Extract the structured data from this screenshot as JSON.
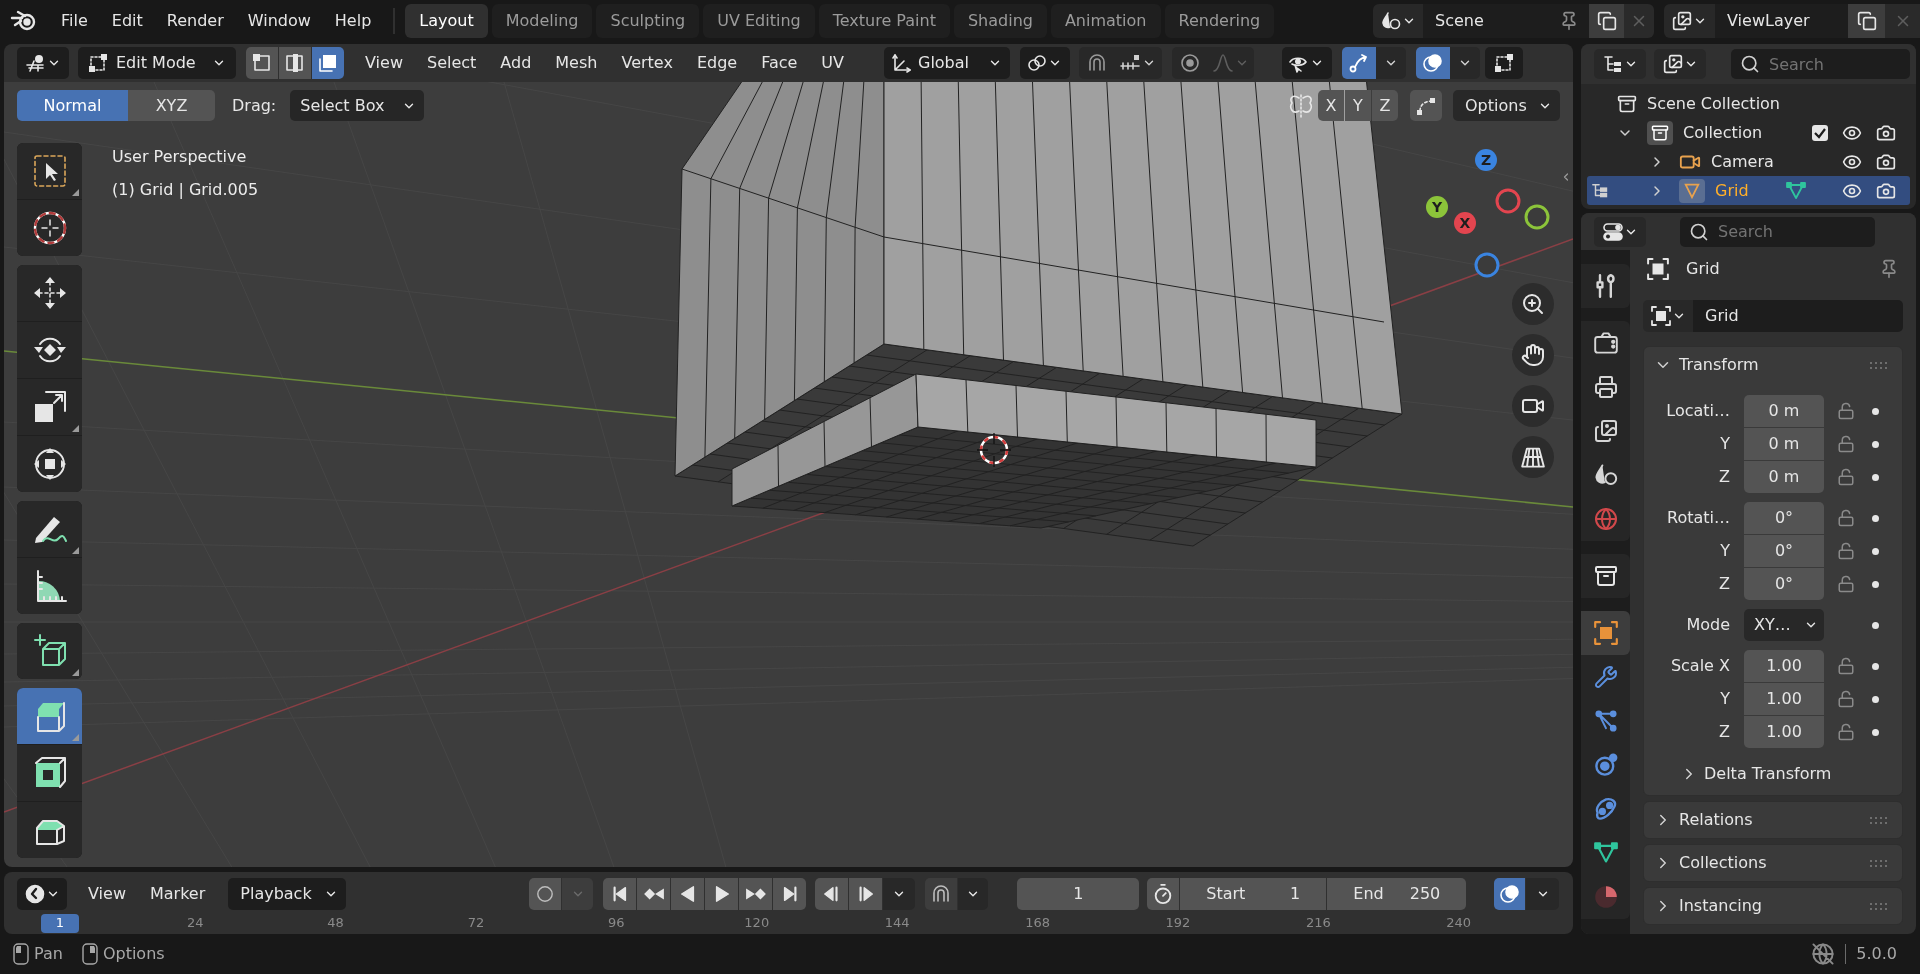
{
  "top_bar": {
    "menus": [
      "File",
      "Edit",
      "Render",
      "Window",
      "Help"
    ],
    "workspaces": [
      {
        "label": "Layout",
        "selected": true
      },
      {
        "label": "Modeling",
        "selected": false
      },
      {
        "label": "Sculpting",
        "selected": false
      },
      {
        "label": "UV Editing",
        "selected": false
      },
      {
        "label": "Texture Paint",
        "selected": false
      },
      {
        "label": "Shading",
        "selected": false
      },
      {
        "label": "Animation",
        "selected": false
      },
      {
        "label": "Rendering",
        "selected": false
      }
    ],
    "scene": "Scene",
    "view_layer": "ViewLayer"
  },
  "viewport": {
    "header": {
      "mode": "Edit Mode",
      "select_modes": [
        {
          "kind": "vertex",
          "selected": false
        },
        {
          "kind": "edge",
          "selected": false
        },
        {
          "kind": "face",
          "selected": true
        }
      ],
      "menus": [
        "View",
        "Select",
        "Add",
        "Mesh",
        "Vertex",
        "Edge",
        "Face",
        "UV"
      ],
      "orientation": "Global",
      "toggles": [
        {
          "kind": "snap",
          "on": false
        },
        {
          "kind": "proportional",
          "on": false
        },
        {
          "kind": "gizmos",
          "on": true
        },
        {
          "kind": "overlays",
          "on": true
        }
      ]
    },
    "tool_settings": {
      "orientations": [
        {
          "label": "Normal",
          "selected": true
        },
        {
          "label": "XYZ",
          "selected": false
        }
      ],
      "drag_label": "Drag:",
      "drag_value": "Select Box",
      "mirror_axes": [
        {
          "label": "X",
          "selected": false
        },
        {
          "label": "Y",
          "selected": false
        },
        {
          "label": "Z",
          "selected": false
        }
      ],
      "options": "Options"
    },
    "info": {
      "view": "User Perspective",
      "object": "(1) Grid | Grid.005"
    },
    "tool_groups": [
      {
        "tools": [
          {
            "kind": "select_box",
            "selected": false,
            "submenu": true
          },
          {
            "kind": "cursor",
            "selected": false,
            "submenu": false
          }
        ]
      },
      {
        "tools": [
          {
            "kind": "move",
            "selected": false,
            "submenu": false
          },
          {
            "kind": "rotate",
            "selected": false,
            "submenu": false
          },
          {
            "kind": "scale",
            "selected": false,
            "submenu": true
          },
          {
            "kind": "transform",
            "selected": false,
            "submenu": false
          }
        ]
      },
      {
        "tools": [
          {
            "kind": "annotate",
            "selected": false,
            "submenu": true
          },
          {
            "kind": "measure",
            "selected": false,
            "submenu": false
          }
        ]
      },
      {
        "tools": [
          {
            "kind": "add_cube",
            "selected": false,
            "submenu": true
          }
        ]
      },
      {
        "tools": [
          {
            "kind": "extrude",
            "selected": true,
            "submenu": true
          },
          {
            "kind": "inset",
            "selected": false,
            "submenu": false
          },
          {
            "kind": "bevel",
            "selected": false,
            "submenu": false
          }
        ]
      }
    ],
    "gizmo_axes": [
      {
        "label": "Z",
        "color": "#3a84e0"
      },
      {
        "label": "Y",
        "color": "#8cc43a"
      },
      {
        "label": "X",
        "color": "#e3454f"
      }
    ]
  },
  "outliner": {
    "search_placeholder": "Search",
    "items": [
      {
        "label": "Scene Collection",
        "kind": "scene_collection",
        "selected": false,
        "children": [
          {
            "label": "Collection",
            "kind": "collection",
            "expanded": true,
            "checked": true,
            "visible": true,
            "renderable": true,
            "selected": false,
            "children": [
              {
                "label": "Camera",
                "kind": "camera",
                "expanded": false,
                "visible": true,
                "renderable": true,
                "selected": false,
                "edit_mode": false
              },
              {
                "label": "Grid",
                "kind": "mesh",
                "expanded": false,
                "visible": true,
                "renderable": true,
                "selected": true,
                "edit_mode": true
              }
            ]
          }
        ]
      }
    ]
  },
  "properties": {
    "search_placeholder": "Search",
    "tab_groups": [
      {
        "tabs": [
          {
            "kind": "tool",
            "selected": false
          }
        ]
      },
      {
        "tabs": [
          {
            "kind": "render",
            "selected": false
          },
          {
            "kind": "output",
            "selected": false
          },
          {
            "kind": "view_layer",
            "selected": false
          },
          {
            "kind": "scene",
            "selected": false
          },
          {
            "kind": "world",
            "selected": false
          }
        ]
      },
      {
        "tabs": [
          {
            "kind": "collection",
            "selected": false
          }
        ]
      },
      {
        "tabs": [
          {
            "kind": "object",
            "selected": true
          },
          {
            "kind": "modifiers",
            "selected": false
          },
          {
            "kind": "particles",
            "selected": false
          },
          {
            "kind": "physics",
            "selected": false
          },
          {
            "kind": "constraints",
            "selected": false
          },
          {
            "kind": "data",
            "selected": false
          },
          {
            "kind": "material",
            "selected": false
          }
        ]
      }
    ],
    "object_name": "Grid",
    "data_name": "Grid",
    "panels": [
      {
        "title": "Transform",
        "expanded": true,
        "groups": [
          {
            "kind": "vector",
            "rows": [
              {
                "label": "Locati…",
                "value": "0 m",
                "locked": false
              },
              {
                "label": "Y",
                "value": "0 m",
                "locked": false
              },
              {
                "label": "Z",
                "value": "0 m",
                "locked": false
              }
            ]
          },
          {
            "kind": "vector",
            "rows": [
              {
                "label": "Rotati…",
                "value": "0°",
                "locked": false
              },
              {
                "label": "Y",
                "value": "0°",
                "locked": false
              },
              {
                "label": "Z",
                "value": "0°",
                "locked": false
              }
            ]
          },
          {
            "kind": "dropdown",
            "label": "Mode",
            "value": "XY…"
          },
          {
            "kind": "vector",
            "rows": [
              {
                "label": "Scale X",
                "value": "1.00",
                "locked": false
              },
              {
                "label": "Y",
                "value": "1.00",
                "locked": false
              },
              {
                "label": "Z",
                "value": "1.00",
                "locked": false
              }
            ]
          }
        ],
        "subpanels": [
          {
            "title": "Delta Transform",
            "expanded": false
          }
        ]
      },
      {
        "title": "Relations",
        "expanded": false
      },
      {
        "title": "Collections",
        "expanded": false
      },
      {
        "title": "Instancing",
        "expanded": false
      }
    ]
  },
  "timeline": {
    "menus": [
      "View",
      "Marker"
    ],
    "playback": "Playback",
    "auto_key": false,
    "current_frame": "1",
    "start_label": "Start",
    "start": "1",
    "end_label": "End",
    "end": "250",
    "preview_range": false,
    "overlays": true,
    "ruler": {
      "current": "1",
      "ticks": [
        "24",
        "48",
        "72",
        "96",
        "120",
        "144",
        "168",
        "192",
        "216",
        "240"
      ]
    }
  },
  "status_bar": {
    "hints": [
      {
        "kind": "mouse_left",
        "label": "Pan"
      },
      {
        "kind": "mouse_right",
        "label": "Options"
      }
    ],
    "version": "5.0.0"
  }
}
